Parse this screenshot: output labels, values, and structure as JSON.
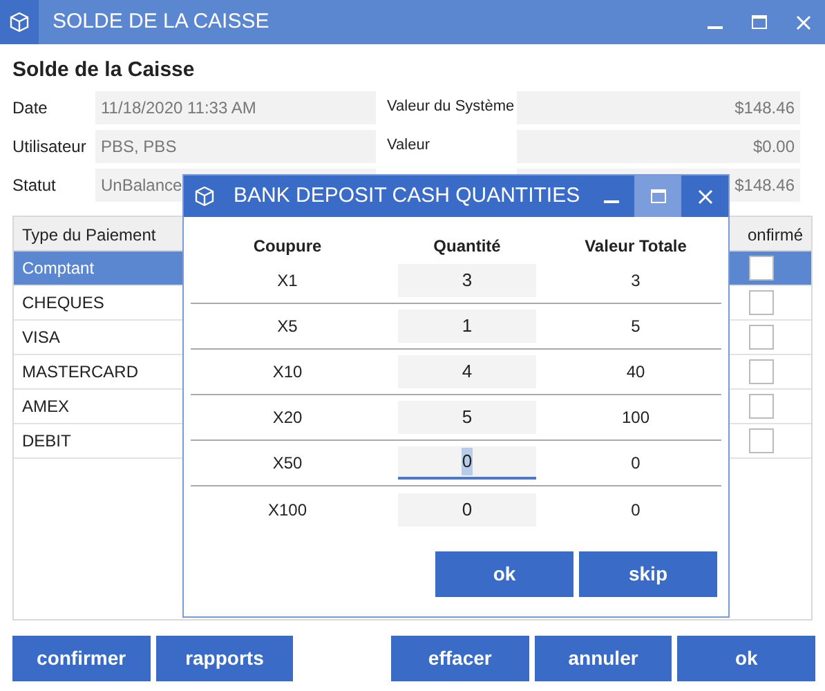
{
  "window": {
    "title": "SOLDE DE LA CAISSE"
  },
  "heading": "Solde de la Caisse",
  "fields_left": [
    {
      "label": "Date",
      "value": "11/18/2020 11:33 AM"
    },
    {
      "label": "Utilisateur",
      "value": "PBS, PBS"
    },
    {
      "label": "Statut",
      "value": "UnBalance"
    }
  ],
  "fields_right": [
    {
      "label": "Valeur du Système",
      "value": "$148.46"
    },
    {
      "label": "Valeur",
      "value": "$0.00"
    },
    {
      "value": "$148.46"
    }
  ],
  "payments": {
    "columns": [
      "Type du Paiement",
      "onfirmé"
    ],
    "rows": [
      {
        "type": "Comptant",
        "selected": true,
        "confirmed": false
      },
      {
        "type": "CHEQUES",
        "selected": false,
        "confirmed": false
      },
      {
        "type": "VISA",
        "selected": false,
        "confirmed": false
      },
      {
        "type": "MASTERCARD",
        "selected": false,
        "confirmed": false
      },
      {
        "type": "AMEX",
        "selected": false,
        "confirmed": false
      },
      {
        "type": "DEBIT",
        "selected": false,
        "confirmed": false
      }
    ]
  },
  "buttons": [
    "confirmer",
    "rapports",
    "effacer",
    "annuler",
    "ok"
  ],
  "dialog": {
    "title": "BANK DEPOSIT CASH QUANTITIES",
    "columns": [
      "Coupure",
      "Quantité",
      "Valeur Totale"
    ],
    "rows": [
      {
        "denomination": "X1",
        "quantity": "3",
        "total": "3",
        "focused": false
      },
      {
        "denomination": "X5",
        "quantity": "1",
        "total": "5",
        "focused": false
      },
      {
        "denomination": "X10",
        "quantity": "4",
        "total": "40",
        "focused": false
      },
      {
        "denomination": "X20",
        "quantity": "5",
        "total": "100",
        "focused": false
      },
      {
        "denomination": "X50",
        "quantity": "0",
        "total": "0",
        "focused": true
      },
      {
        "denomination": "X100",
        "quantity": "0",
        "total": "0",
        "focused": false
      }
    ],
    "buttons": [
      "ok",
      "skip"
    ]
  }
}
